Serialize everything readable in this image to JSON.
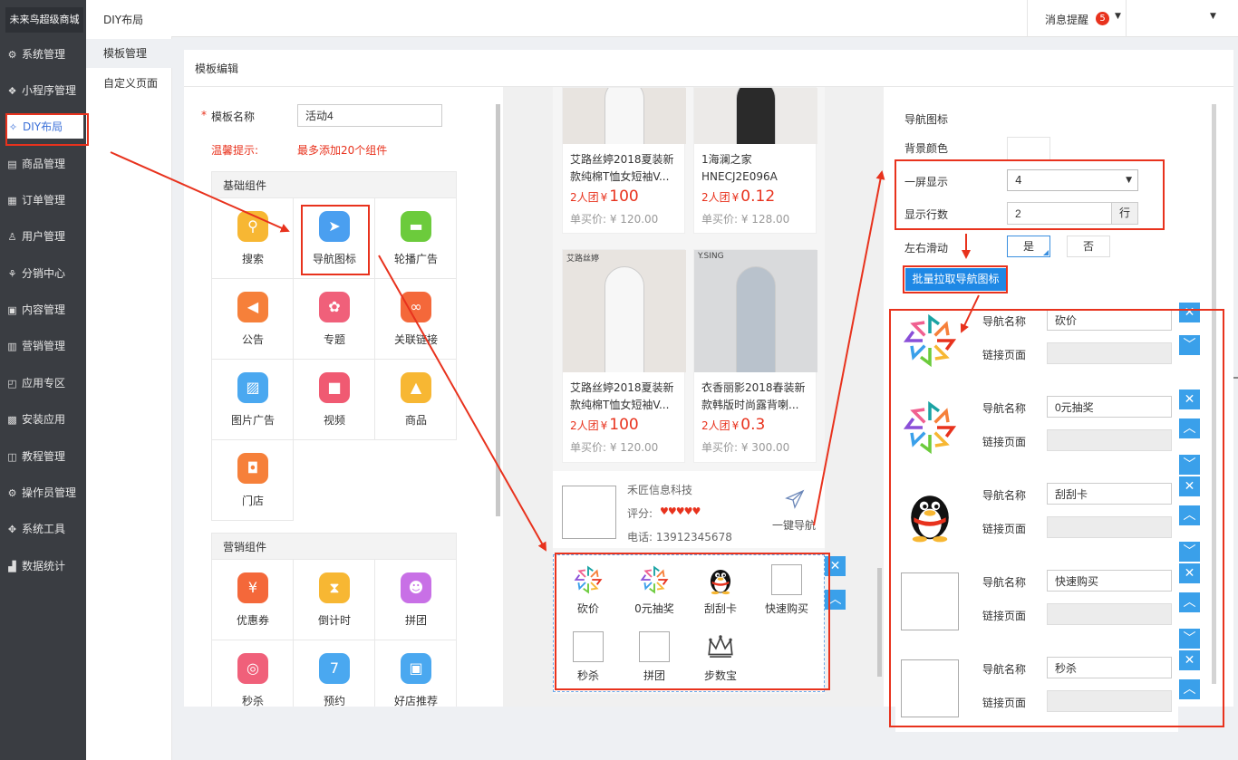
{
  "app": {
    "brand": "未来鸟超级商城",
    "header_title": "DIY布局",
    "notice_label": "消息提醒",
    "notice_count": "5"
  },
  "sidebar": [
    {
      "icon": "gear-icon",
      "glyph": "⚙",
      "label": "系统管理"
    },
    {
      "icon": "miniapp-icon",
      "glyph": "❖",
      "label": "小程序管理"
    },
    {
      "icon": "diy-icon",
      "glyph": "✧",
      "label": "DIY布局"
    },
    {
      "icon": "goods-icon",
      "glyph": "▤",
      "label": "商品管理"
    },
    {
      "icon": "order-icon",
      "glyph": "▦",
      "label": "订单管理"
    },
    {
      "icon": "user-icon",
      "glyph": "♙",
      "label": "用户管理"
    },
    {
      "icon": "share-icon",
      "glyph": "⚘",
      "label": "分销中心"
    },
    {
      "icon": "content-icon",
      "glyph": "▣",
      "label": "内容管理"
    },
    {
      "icon": "marketing-icon",
      "glyph": "▥",
      "label": "营销管理"
    },
    {
      "icon": "app-icon",
      "glyph": "◰",
      "label": "应用专区"
    },
    {
      "icon": "install-icon",
      "glyph": "▩",
      "label": "安装应用"
    },
    {
      "icon": "tutorial-icon",
      "glyph": "◫",
      "label": "教程管理"
    },
    {
      "icon": "operator-icon",
      "glyph": "⚙",
      "label": "操作员管理"
    },
    {
      "icon": "tools-icon",
      "glyph": "✥",
      "label": "系统工具"
    },
    {
      "icon": "stats-icon",
      "glyph": "▟",
      "label": "数据统计"
    }
  ],
  "subnav": [
    "模板管理",
    "自定义页面"
  ],
  "editor": {
    "title": "模板编辑",
    "name_label": "模板名称",
    "name_value": "活动4",
    "tip_label": "温馨提示:",
    "tip_text": "最多添加20个组件",
    "basic_title": "基础组件",
    "basic": [
      {
        "label": "搜索",
        "icon": "search-icon",
        "glyph": "⚲",
        "color": "#f7b733"
      },
      {
        "label": "导航图标",
        "icon": "navigation-icon",
        "glyph": "➤",
        "color": "#4a9ff0"
      },
      {
        "label": "轮播广告",
        "icon": "carousel-icon",
        "glyph": "▬",
        "color": "#6ccb3c"
      },
      {
        "label": "公告",
        "icon": "notice-icon",
        "glyph": "◀",
        "color": "#f6803a"
      },
      {
        "label": "专题",
        "icon": "topic-icon",
        "glyph": "✿",
        "color": "#f0607a"
      },
      {
        "label": "关联链接",
        "icon": "link-icon",
        "glyph": "∞",
        "color": "#f4683a"
      },
      {
        "label": "图片广告",
        "icon": "image-icon",
        "glyph": "▨",
        "color": "#4aa8f0"
      },
      {
        "label": "视频",
        "icon": "video-icon",
        "glyph": "■",
        "color": "#f05a72"
      },
      {
        "label": "商品",
        "icon": "bag-icon",
        "glyph": "▲",
        "color": "#f7b733"
      },
      {
        "label": "门店",
        "icon": "store-icon",
        "glyph": "◘",
        "color": "#f6803a"
      }
    ],
    "marketing_title": "营销组件",
    "marketing": [
      {
        "label": "优惠券",
        "icon": "coupon-icon",
        "glyph": "¥",
        "color": "#f4683a"
      },
      {
        "label": "倒计时",
        "icon": "hourglass-icon",
        "glyph": "⧗",
        "color": "#f7b733"
      },
      {
        "label": "拼团",
        "icon": "group-icon",
        "glyph": "☻",
        "color": "#c870e6"
      },
      {
        "label": "秒杀",
        "icon": "alarm-icon",
        "glyph": "◎",
        "color": "#f0607a"
      },
      {
        "label": "预约",
        "icon": "calendar-icon",
        "glyph": "7",
        "color": "#4aa8f0"
      },
      {
        "label": "好店推荐",
        "icon": "shop-icon",
        "glyph": "▣",
        "color": "#4aa8f0"
      }
    ]
  },
  "preview": {
    "products": [
      {
        "title": "艾路丝婷2018夏装新款纯棉T恤女短袖V...",
        "group": "2人团",
        "price": "100",
        "single": "单买价: ¥ 120.00",
        "cur": "¥"
      },
      {
        "title": "1海澜之家 HNECJ2E096A",
        "group": "2人团",
        "price": "0.12",
        "single": "单买价: ¥ 128.00",
        "cur": "¥"
      },
      {
        "title": "艾路丝婷2018夏装新款纯棉T恤女短袖V...",
        "group": "2人团",
        "price": "100",
        "single": "单买价: ¥ 120.00",
        "cur": "¥",
        "brand": "艾路丝婷"
      },
      {
        "title": "衣香丽影2018春装新款韩版时尚露背喇...",
        "group": "2人团",
        "price": "0.3",
        "single": "单买价: ¥ 300.00",
        "cur": "¥",
        "brand": "Y.SING"
      }
    ],
    "store": {
      "name": "禾匠信息科技",
      "rating_label": "评分:",
      "stars": "♥♥♥♥♥",
      "phone": "电话: 13912345678",
      "nav": "一键导航"
    },
    "nav_icons": [
      {
        "label": "砍价",
        "kind": "pinwheel"
      },
      {
        "label": "0元抽奖",
        "kind": "pinwheel"
      },
      {
        "label": "刮刮卡",
        "kind": "penguin"
      },
      {
        "label": "快速购买",
        "kind": "blank"
      },
      {
        "label": "秒杀",
        "kind": "blank"
      },
      {
        "label": "拼团",
        "kind": "blank"
      },
      {
        "label": "步数宝",
        "kind": "crown"
      }
    ]
  },
  "settings": {
    "title": "导航图标",
    "bg_label": "背景颜色",
    "per_screen_label": "一屏显示",
    "per_screen_value": "4",
    "rows_label": "显示行数",
    "rows_value": "2",
    "rows_unit": "行",
    "slide_label": "左右滑动",
    "yes": "是",
    "no": "否",
    "batch_button": "批量拉取导航图标",
    "name_label": "导航名称",
    "link_label": "链接页面",
    "items": [
      {
        "name": "砍价",
        "kind": "pinwheel"
      },
      {
        "name": "0元抽奖",
        "kind": "pinwheel"
      },
      {
        "name": "刮刮卡",
        "kind": "penguin"
      },
      {
        "name": "快速购买",
        "kind": "blank"
      },
      {
        "name": "秒杀",
        "kind": "blank"
      }
    ]
  }
}
